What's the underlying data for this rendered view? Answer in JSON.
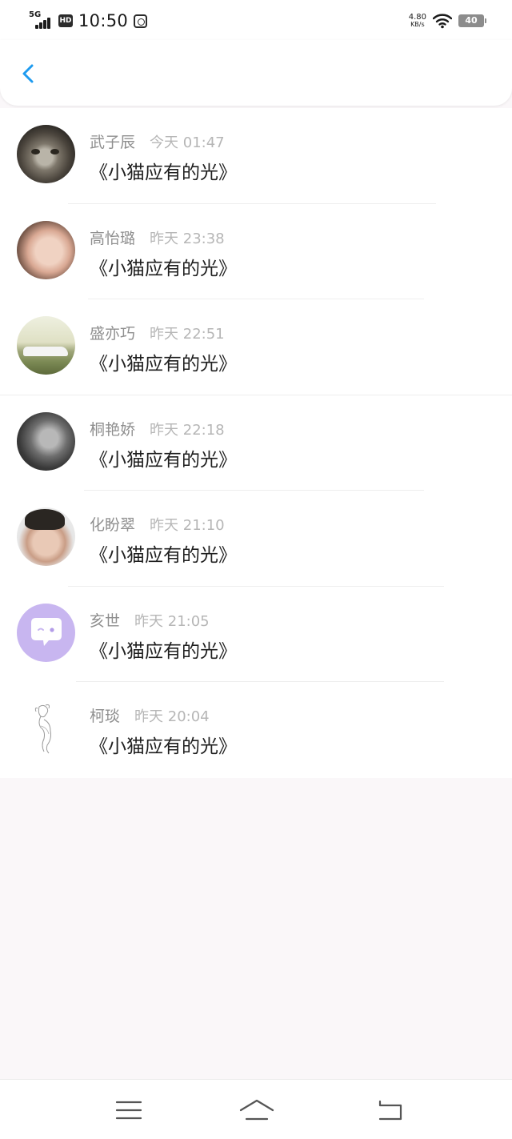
{
  "status_bar": {
    "network": "5G",
    "hd": "HD",
    "time": "10:50",
    "net_speed_value": "4.80",
    "net_speed_unit": "KB/s",
    "battery": "40"
  },
  "header": {
    "back_icon": "chevron-left-icon"
  },
  "items": [
    {
      "name": "武子辰",
      "time": "今天 01:47",
      "title": "《小猫应有的光》",
      "avatar": "cat-photo"
    },
    {
      "name": "高怡璐",
      "time": "昨天 23:38",
      "title": "《小猫应有的光》",
      "avatar": "baby-photo"
    },
    {
      "name": "盛亦巧",
      "time": "昨天 22:51",
      "title": "《小猫应有的光》",
      "avatar": "car-photo"
    },
    {
      "name": "桐艳娇",
      "time": "昨天 22:18",
      "title": "《小猫应有的光》",
      "avatar": "man-photo"
    },
    {
      "name": "化盼翠",
      "time": "昨天 21:10",
      "title": "《小猫应有的光》",
      "avatar": "boy-photo"
    },
    {
      "name": "亥世",
      "time": "昨天 21:05",
      "title": "《小猫应有的光》",
      "avatar": "chat-bubble-avatar"
    },
    {
      "name": "柯琰",
      "time": "昨天 20:04",
      "title": "《小猫应有的光》",
      "avatar": "sketch-avatar"
    }
  ],
  "bottom_nav": {
    "menu_icon": "menu-icon",
    "home_icon": "home-icon",
    "back_icon": "back-icon"
  },
  "colors": {
    "accent": "#1e9bf0",
    "name_text": "#8f8f8f",
    "time_text": "#b6b6b6",
    "title_text": "#1f1f1f",
    "page_bg": "#faf7f9",
    "chat_avatar": "#c8b6f0"
  }
}
